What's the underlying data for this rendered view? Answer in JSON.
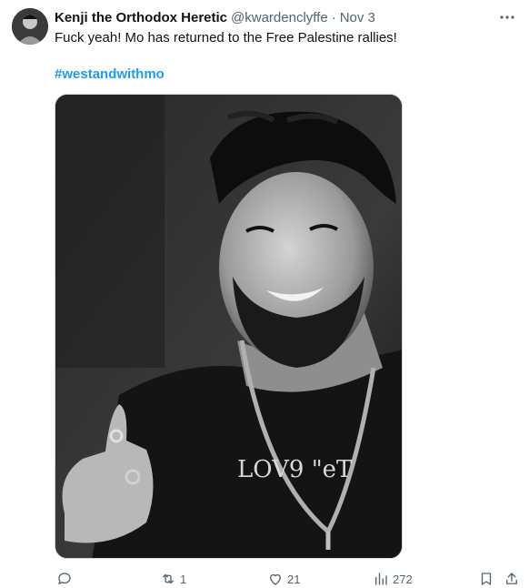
{
  "author": {
    "display_name": "Kenji the Orthodox Heretic",
    "handle": "@kwardenclyffe",
    "separator": "·",
    "date": "Nov 3"
  },
  "tweet": {
    "text": "Fuck yeah! Mo has returned to the Free Palestine rallies!",
    "hashtag": "#westandwithmo"
  },
  "media": {
    "shirt_text": "LOV9 \"eT"
  },
  "actions": {
    "reply_count": "",
    "retweet_count": "1",
    "like_count": "21",
    "view_count": "272"
  },
  "colors": {
    "link": "#1d9bf0",
    "secondary_text": "#536471",
    "primary_text": "#0f1419"
  }
}
